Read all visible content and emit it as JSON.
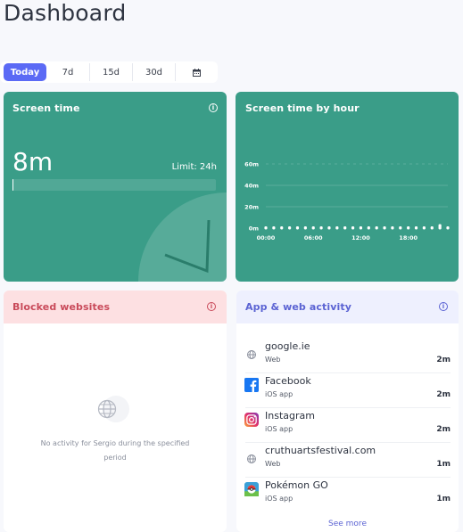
{
  "page": {
    "title": "Dashboard"
  },
  "range": {
    "options": [
      "Today",
      "7d",
      "15d",
      "30d"
    ],
    "active": "Today",
    "calendar_icon": "calendar-icon"
  },
  "screen_time": {
    "title": "Screen time",
    "value": "8m",
    "limit": "Limit: 24h",
    "usage_fraction": 0.006,
    "info_icon": "info-icon"
  },
  "by_hour": {
    "title": "Screen time by hour",
    "info_icon": "info-icon"
  },
  "chart_data": {
    "type": "bar",
    "title": "Screen time by hour",
    "categories": [
      "00:00",
      "01:00",
      "02:00",
      "03:00",
      "04:00",
      "05:00",
      "06:00",
      "07:00",
      "08:00",
      "09:00",
      "10:00",
      "11:00",
      "12:00",
      "13:00",
      "14:00",
      "15:00",
      "16:00",
      "17:00",
      "18:00",
      "19:00",
      "20:00",
      "21:00",
      "22:00",
      "23:00"
    ],
    "x_tick_labels": [
      "00:00",
      "06:00",
      "12:00",
      "18:00"
    ],
    "values": [
      0,
      0,
      0,
      0,
      0,
      0,
      0,
      0,
      0,
      0,
      0,
      0,
      0,
      0,
      0,
      0,
      0,
      0,
      0,
      0,
      0,
      0,
      5,
      0
    ],
    "y_tick_labels": [
      "0m",
      "20m",
      "40m",
      "60m"
    ],
    "ylim": [
      0,
      60
    ],
    "grid": true,
    "colors": {
      "background": "#3a9d88",
      "bar": "#ffffff"
    }
  },
  "blocked": {
    "title": "Blocked websites",
    "info_icon": "info-icon",
    "empty_icon": "globe-icon",
    "empty_line1": "No activity for Sergio during the specified",
    "empty_line2": "period"
  },
  "activity": {
    "title": "App & web activity",
    "info_icon": "info-icon",
    "items": [
      {
        "name": "google.ie",
        "type": "Web",
        "time": "2m",
        "icon": "globe-icon"
      },
      {
        "name": "Facebook",
        "type": "iOS app",
        "time": "2m",
        "icon": "facebook-icon"
      },
      {
        "name": "Instagram",
        "type": "iOS app",
        "time": "2m",
        "icon": "instagram-icon"
      },
      {
        "name": "cruthuartsfestival.com",
        "type": "Web",
        "time": "1m",
        "icon": "globe-icon"
      },
      {
        "name": "Pokémon GO",
        "type": "iOS app",
        "time": "1m",
        "icon": "pokemon-go-icon"
      }
    ],
    "see_more": "See more"
  },
  "colors": {
    "teal": "#3a9d88",
    "accent": "#5b6af5",
    "blocked_header": "#fde0e2",
    "blocked_title": "#c94a5a",
    "activity_header": "#eef0fe",
    "activity_title": "#5b63d3"
  }
}
